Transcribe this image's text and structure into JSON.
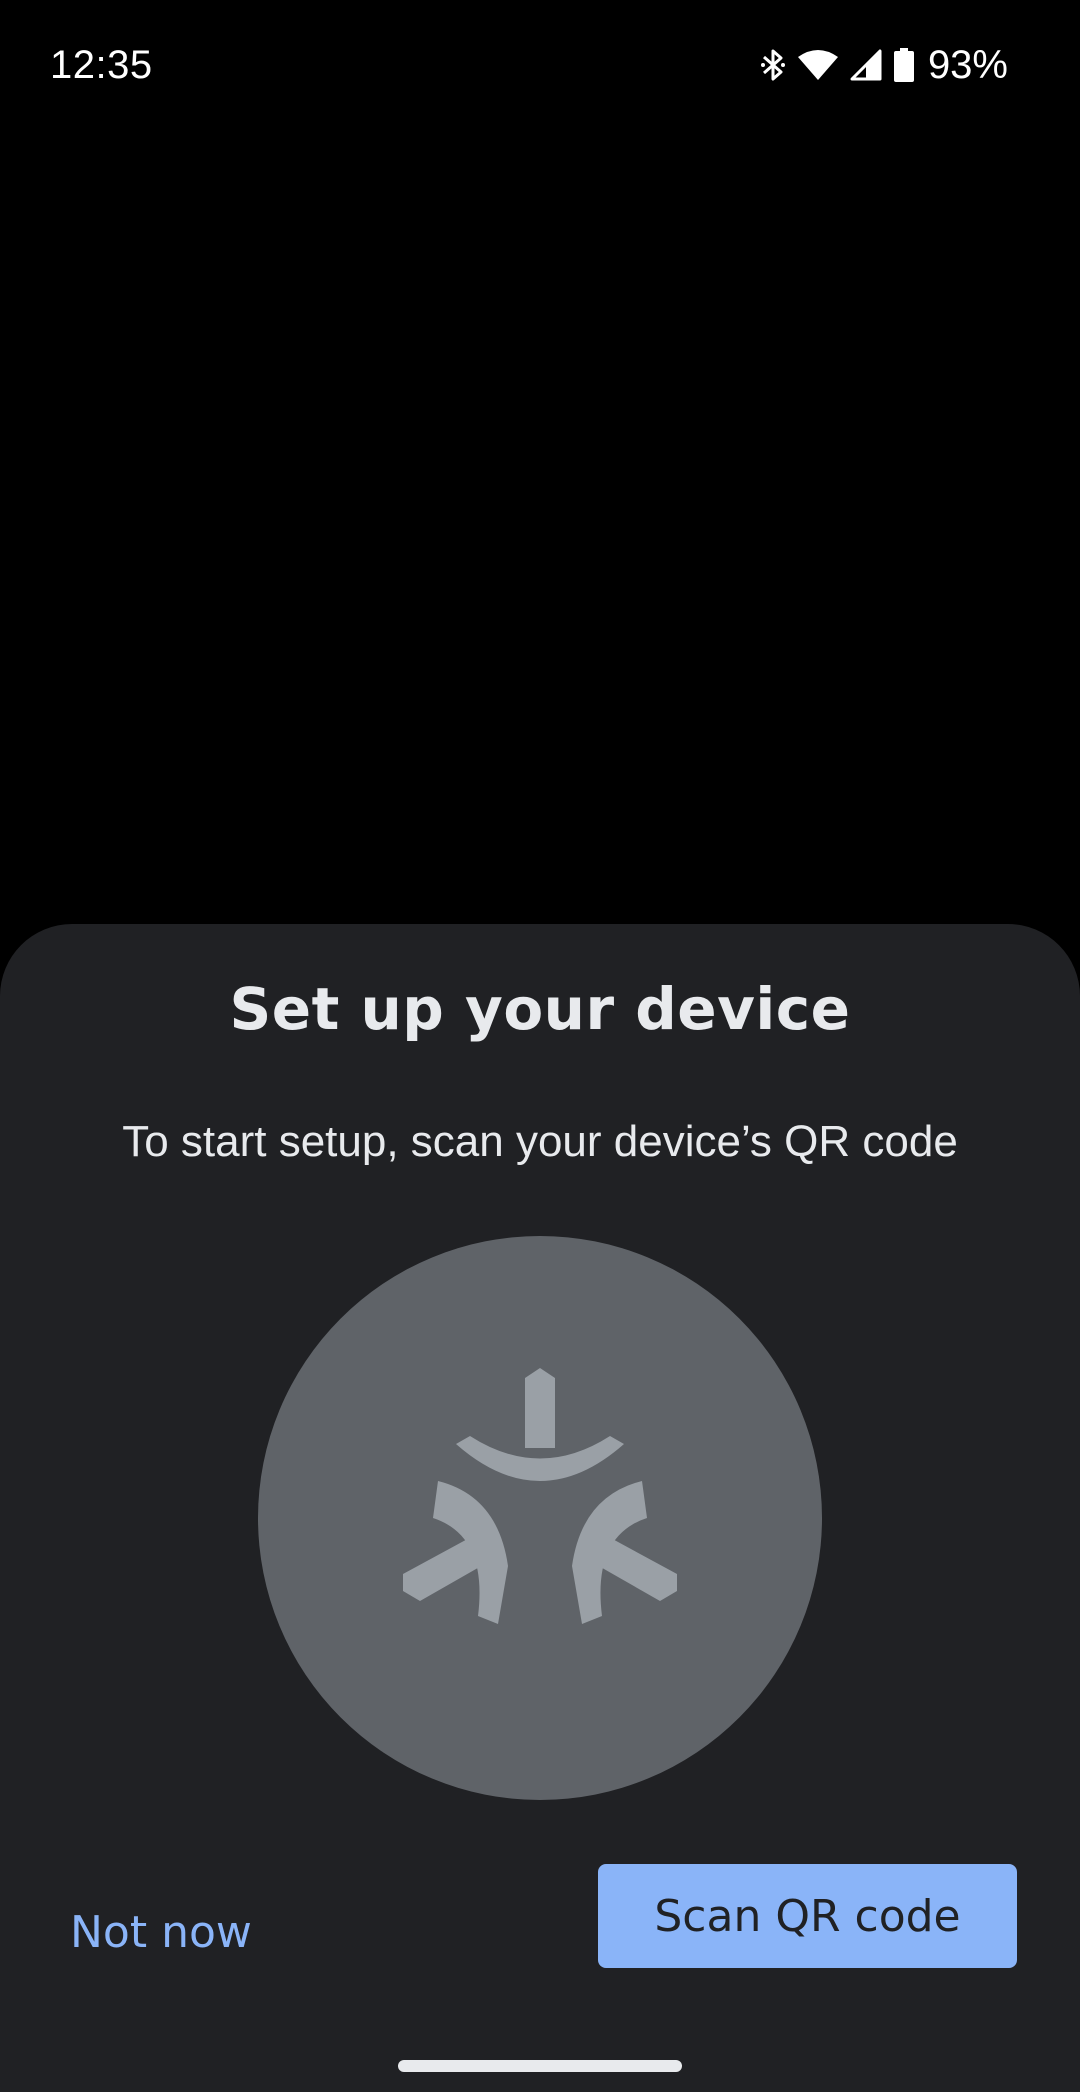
{
  "status_bar": {
    "time": "12:35",
    "battery_percent": "93%",
    "icons": [
      "bluetooth-icon",
      "wifi-icon",
      "cell-signal-icon",
      "battery-icon"
    ]
  },
  "sheet": {
    "title": "Set up your device",
    "subtitle": "To start setup, scan your device’s QR code",
    "illustration_icon": "matter-logo-icon",
    "not_now_label": "Not now",
    "scan_label": "Scan QR code"
  },
  "colors": {
    "background": "#000000",
    "sheet": "#202124",
    "text": "#e8eaed",
    "accent": "#8ab4f8",
    "illustration_circle": "#5f6368",
    "illustration_logo": "#9aa0a6"
  }
}
